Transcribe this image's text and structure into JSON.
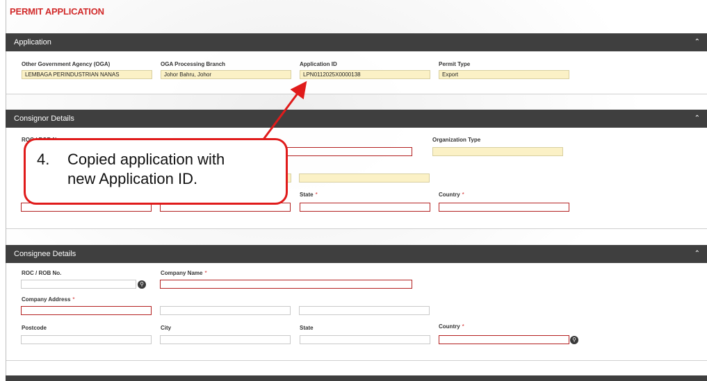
{
  "page": {
    "title": "PERMIT APPLICATION"
  },
  "icons": {
    "collapse": "chevron-up-icon",
    "search": "search-icon"
  },
  "application": {
    "header": "Application",
    "oga_label": "Other Government Agency (OGA)",
    "oga_value": "LEMBAGA PERINDUSTRIAN NANAS",
    "branch_label": "OGA Processing Branch",
    "branch_value": "Johor Bahru, Johor",
    "appid_label": "Application ID",
    "appid_value": "LPN0112025X0000138",
    "permit_label": "Permit Type",
    "permit_value": "Export"
  },
  "consignor": {
    "header": "Consignor Details",
    "roc_label": "ROC / ROB No.",
    "org_type_label": "Organization Type",
    "state_label": "State",
    "country_label": "Country",
    "required_mark": "*"
  },
  "consignee": {
    "header": "Consignee Details",
    "roc_label": "ROC / ROB No.",
    "company_name_label": "Company Name",
    "company_address_label": "Company Address",
    "postcode_label": "Postcode",
    "city_label": "City",
    "state_label": "State",
    "country_label": "Country",
    "required_mark": "*"
  },
  "callout": {
    "number": "4.",
    "line1": "Copied application with",
    "line2": "new Application ID.",
    "color": "#e01b1b"
  }
}
